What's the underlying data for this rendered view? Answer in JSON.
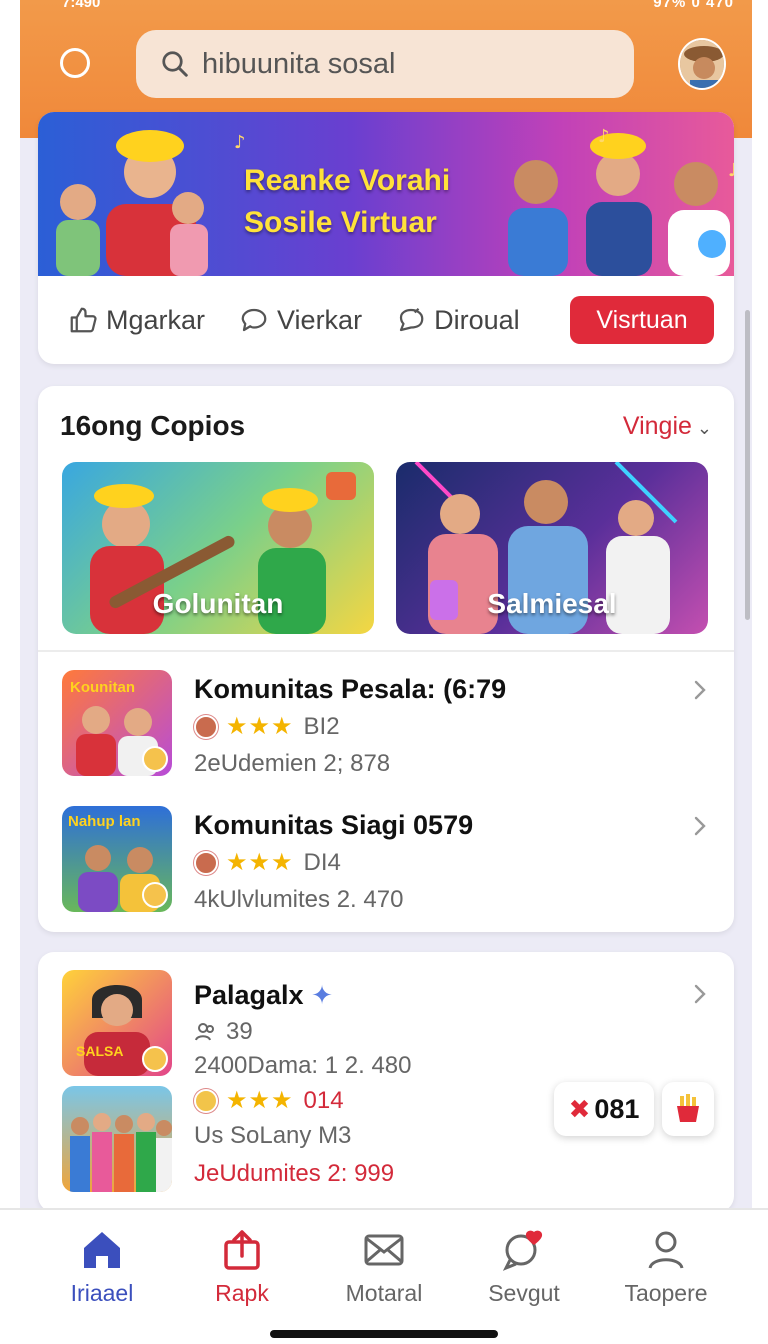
{
  "status_bar": {
    "time": "7:490",
    "right": "97% 0 470"
  },
  "header": {
    "search_text": "hibuunita sosal"
  },
  "banner": {
    "title_line1": "Reanke Vorahi",
    "title_line2": "Sosile Virtuar",
    "actions": [
      "Mgarkar",
      "Vierkar",
      "Diroual"
    ],
    "visit_label": "Visrtuan"
  },
  "section": {
    "title": "16ong Copios",
    "filter_label": "Vingie",
    "tiles": [
      {
        "label": "Golunitan"
      },
      {
        "label": "Salmiesal"
      }
    ],
    "communities": [
      {
        "thumb_label": "Kounitan",
        "title": "Komunitas Pesala: (6:79",
        "rating_code": "BI2",
        "subtitle": "2eUdemien 2; 878"
      },
      {
        "thumb_label": "Nahup lan",
        "title": "Komunitas Siagi 0579",
        "rating_code": "DI4",
        "subtitle": "4kUlvlumites 2. 470"
      }
    ]
  },
  "card3": {
    "title": "Palagalx",
    "members": "39",
    "line1": "2400Dama: 1 2. 480",
    "rating_code": "014",
    "line2": "Us SoLany M3",
    "line3": "JeUdumites 2: 999",
    "thumb_label": "SALSA",
    "pill_value": "081"
  },
  "nav": {
    "items": [
      {
        "label": "Iriaael",
        "icon": "home-icon",
        "color": "#3b4fbd"
      },
      {
        "label": "Rapk",
        "icon": "share-box-icon",
        "color": "#d32a3a"
      },
      {
        "label": "Motaral",
        "icon": "mail-icon",
        "color": "#666666"
      },
      {
        "label": "Sevgut",
        "icon": "chat-heart-icon",
        "color": "#666666"
      },
      {
        "label": "Taopere",
        "icon": "profile-icon",
        "color": "#666666"
      }
    ]
  },
  "colors": {
    "header": "#f0883a",
    "accent_red": "#e02a3a",
    "star": "#f4b400",
    "nav_active": "#3b4fbd"
  }
}
